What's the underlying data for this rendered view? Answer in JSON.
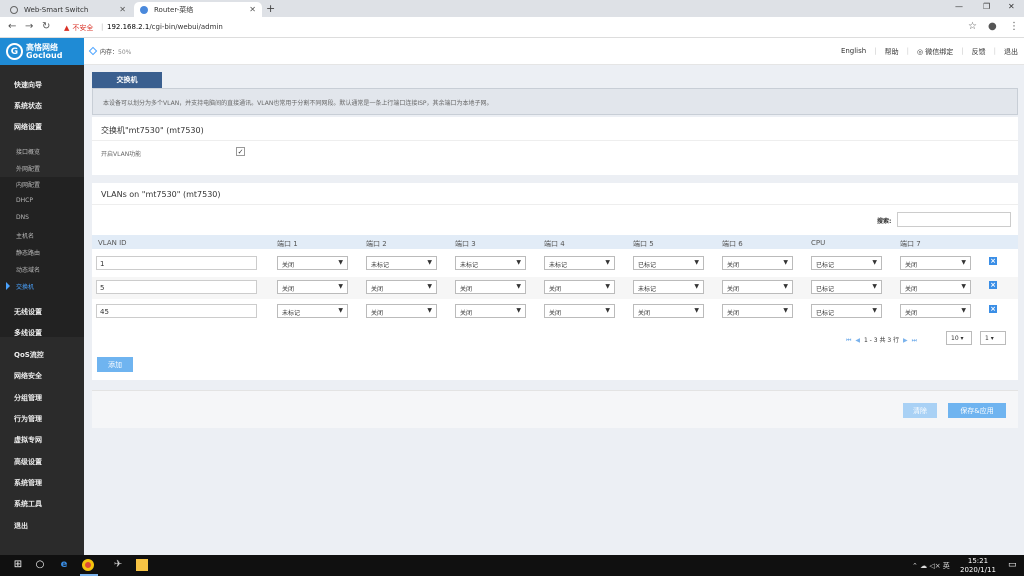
{
  "browser": {
    "tabs": [
      {
        "title": "Web-Smart Switch"
      },
      {
        "title": "Router-菜络"
      }
    ],
    "new_tab": "+",
    "window_controls": {
      "minimize": "—",
      "restore": "❐",
      "close": "✕"
    },
    "address": {
      "insecure_label": "不安全",
      "separator": "|",
      "host": "192.168.2.1",
      "path": "/cgi-bin/webui/admin"
    }
  },
  "sidebar": {
    "logo_cn": "高恪网络",
    "logo_en": "Gocloud",
    "menu": [
      "快速向导",
      "系统状态",
      "网络设置"
    ],
    "submenu": [
      "接口概览",
      "外网配置",
      "内网配置",
      "DHCP",
      "DNS",
      "主机名",
      "静态路由",
      "动态域名",
      "交换机"
    ],
    "menu2": [
      "无线设置",
      "多线设置",
      "QoS流控",
      "网络安全",
      "分组管理",
      "行为管理",
      "虚拟专网",
      "高级设置",
      "系统管理",
      "系统工具",
      "退出"
    ]
  },
  "topbar": {
    "mem_label": "内存：",
    "mem_value": "50%",
    "links": [
      "English",
      "帮助",
      "微信绑定",
      "反馈",
      "退出"
    ]
  },
  "main": {
    "tab_label": "交换机",
    "description": "本设备可以划分为多个VLAN，并支持电脑间的直接通讯。VLAN也常用于分割不同网段。默认通常是一条上行端口连接ISP，其余端口为本地子网。",
    "panel1": {
      "title": "交换机\"mt7530\" (mt7530)",
      "vlan_label": "开启VLAN功能",
      "vlan_checked": "✓"
    },
    "panel2": {
      "title": "VLANs on \"mt7530\" (mt7530)",
      "search_label": "搜索:",
      "columns": [
        "VLAN ID",
        "端口 1",
        "端口 2",
        "端口 3",
        "端口 4",
        "端口 5",
        "端口 6",
        "CPU",
        "端口 7"
      ],
      "rows": [
        {
          "id": "1",
          "ports": [
            "关闭",
            "未标记",
            "未标记",
            "未标记",
            "已标记",
            "关闭",
            "已标记",
            "关闭"
          ]
        },
        {
          "id": "5",
          "ports": [
            "关闭",
            "关闭",
            "关闭",
            "关闭",
            "未标记",
            "关闭",
            "已标记",
            "关闭"
          ]
        },
        {
          "id": "45",
          "ports": [
            "未标记",
            "关闭",
            "关闭",
            "关闭",
            "关闭",
            "关闭",
            "已标记",
            "关闭"
          ]
        }
      ],
      "pager_text": "1 - 3 共 3 行",
      "page_size": "10",
      "page_num": "1",
      "add_label": "添加"
    },
    "actions": {
      "clear_label": "清除",
      "save_label": "保存&应用"
    }
  },
  "taskbar": {
    "tray": "⌃ ☁ ◁× 英",
    "time": "15:21",
    "date": "2020/1/11"
  }
}
